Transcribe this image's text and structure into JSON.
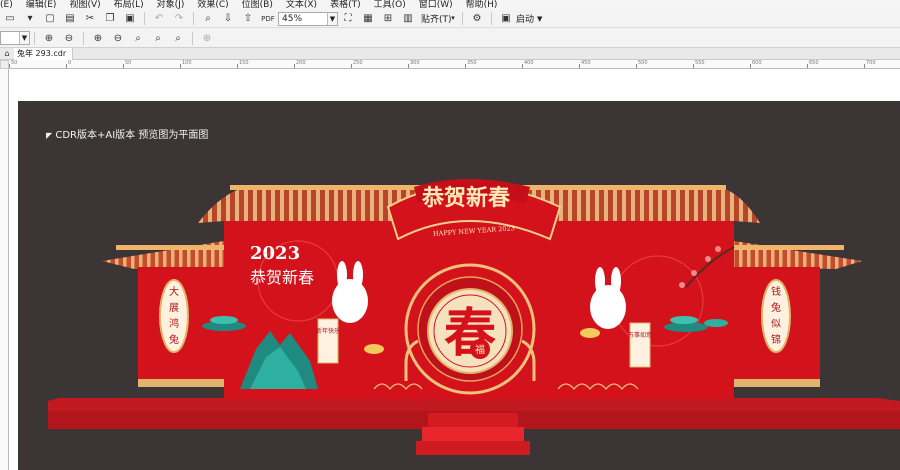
{
  "menubar": {
    "items": [
      "(E)",
      "编辑(E)",
      "视图(V)",
      "布局(L)",
      "对象(J)",
      "效果(C)",
      "位图(B)",
      "文本(X)",
      "表格(T)",
      "工具(O)",
      "窗口(W)",
      "帮助(H)"
    ]
  },
  "toolbar": {
    "zoom_value": "45%",
    "snap_label": "贴齐(T)",
    "launch_label": "启动"
  },
  "tab": {
    "label": "兔年 293.cdr"
  },
  "ruler": {
    "ticks": [
      "50",
      "0",
      "50",
      "100",
      "150",
      "200",
      "250",
      "300",
      "350",
      "400",
      "450",
      "500",
      "550",
      "600",
      "650",
      "700"
    ]
  },
  "artboard": {
    "note": "CDR版本+AI版本 预览图为平面图",
    "banner_title": "恭贺新春",
    "banner_sub": "HAPPY NEW YEAR 2023",
    "logo_year": "2023",
    "logo_text": "恭贺新春",
    "center_char": "春",
    "center_small": "福",
    "left_scroll": [
      "大",
      "展",
      "鸿",
      "兔"
    ],
    "right_scroll": [
      "钱",
      "兔",
      "似",
      "锦"
    ],
    "left_couplet": "新年快乐",
    "right_couplet": "万事如意"
  },
  "colors": {
    "canvas": "#3c3536",
    "red": "#d4121b",
    "gold": "#e2b36a",
    "floor": "#c21820"
  }
}
